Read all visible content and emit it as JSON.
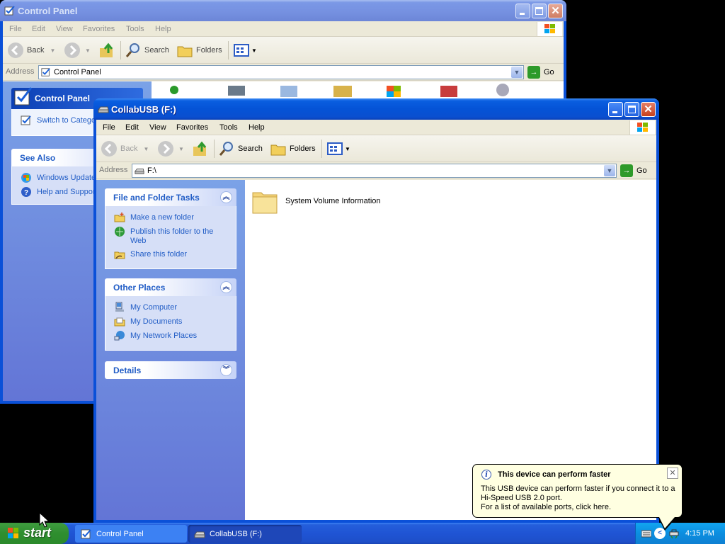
{
  "control_panel_window": {
    "title": "Control Panel",
    "menu": [
      "File",
      "Edit",
      "View",
      "Favorites",
      "Tools",
      "Help"
    ],
    "toolbar": {
      "back": "Back",
      "search": "Search",
      "folders": "Folders"
    },
    "address": {
      "label": "Address",
      "value": "Control Panel",
      "go": "Go"
    },
    "taskpane": {
      "control_panel_header": "Control Panel",
      "switch_link": "Switch to Category View",
      "see_also_header": "See Also",
      "see_also_items": [
        "Windows Update",
        "Help and Support"
      ]
    }
  },
  "explorer_window": {
    "title": "CollabUSB (F:)",
    "menu": [
      "File",
      "Edit",
      "View",
      "Favorites",
      "Tools",
      "Help"
    ],
    "toolbar": {
      "back": "Back",
      "search": "Search",
      "folders": "Folders"
    },
    "address": {
      "label": "Address",
      "value": "F:\\",
      "go": "Go"
    },
    "file_folder_tasks": {
      "header": "File and Folder Tasks",
      "items": [
        "Make a new folder",
        "Publish this folder to the Web",
        "Share this folder"
      ]
    },
    "other_places": {
      "header": "Other Places",
      "items": [
        "My Computer",
        "My Documents",
        "My Network Places"
      ]
    },
    "details": {
      "header": "Details"
    },
    "files": [
      {
        "name": "System Volume Information",
        "type": "folder"
      }
    ]
  },
  "balloon": {
    "title": "This device can perform faster",
    "lines": [
      "This USB device can perform faster if you connect it to a",
      "Hi-Speed USB 2.0 port.",
      "For a list of available ports, click here."
    ]
  },
  "taskbar": {
    "start_label": "start",
    "tasks": [
      "Control Panel",
      "CollabUSB (F:)"
    ],
    "clock": "4:15 PM"
  },
  "colors": {
    "title_active": "#0553d6",
    "taskpane_link": "#215dc6",
    "start_green": "#2f8e2f",
    "taskbar_blue": "#1f54d4",
    "balloon_bg": "#ffffe1"
  }
}
